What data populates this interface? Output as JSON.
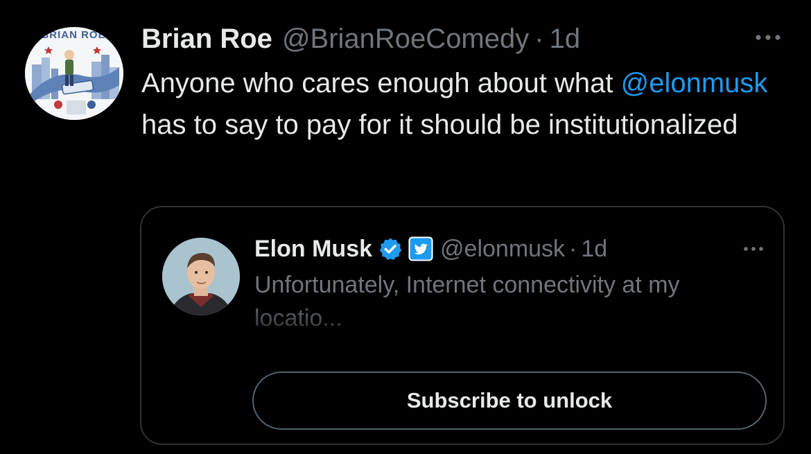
{
  "tweet": {
    "author_name": "Brian Roe",
    "author_handle": "@BrianRoeComedy",
    "separator": "·",
    "time": "1d",
    "avatar_text": "BRIAN ROE",
    "text_before_mention": "Anyone who cares enough about what",
    "mention": "@elonmusk",
    "text_after_mention": "has to say to pay for it should be institutionalized",
    "more_icon": "more-horizontal-icon",
    "mention_color": "#1d9bf0"
  },
  "quote": {
    "author_name": "Elon Musk",
    "verified_badge_icon": "verified-badge-icon",
    "affiliate_badge_icon": "twitter-bird-icon",
    "author_handle": "@elonmusk",
    "separator": "·",
    "time": "1d",
    "text": "Unfortunately, Internet connectivity at my locatio...",
    "more_icon": "more-horizontal-icon",
    "subscribe_label": "Subscribe to unlock",
    "badge_color": "#1d9bf0"
  }
}
